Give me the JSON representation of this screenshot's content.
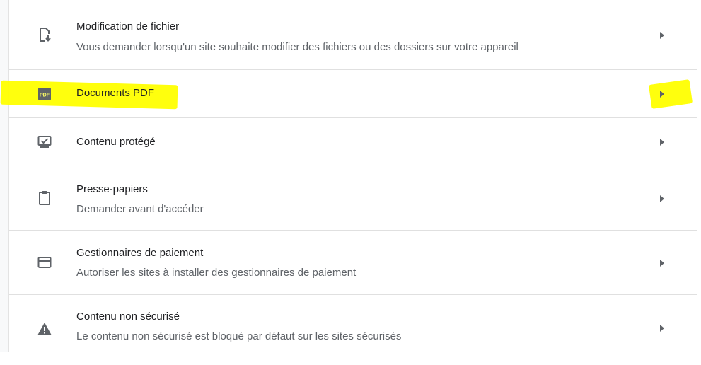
{
  "settings": {
    "items": [
      {
        "icon": "file-edit-icon",
        "title": "Modification de fichier",
        "subtitle": "Vous demander lorsqu'un site souhaite modifier des fichiers ou des dossiers sur votre appareil"
      },
      {
        "icon": "pdf-icon",
        "icon_text": "PDF",
        "title": "Documents PDF",
        "subtitle": ""
      },
      {
        "icon": "protected-content-icon",
        "title": "Contenu protégé",
        "subtitle": ""
      },
      {
        "icon": "clipboard-icon",
        "title": "Presse-papiers",
        "subtitle": "Demander avant d'accéder"
      },
      {
        "icon": "payment-card-icon",
        "title": "Gestionnaires de paiement",
        "subtitle": "Autoriser les sites à installer des gestionnaires de paiement"
      },
      {
        "icon": "warning-icon",
        "title": "Contenu non sécurisé",
        "subtitle": "Le contenu non sécurisé est bloqué par défaut sur les sites sécurisés"
      }
    ]
  },
  "colors": {
    "highlight": "#ffff00",
    "title_text": "#202124",
    "subtitle_text": "#5f6368",
    "icon": "#5f6368",
    "divider": "#e0e0e0"
  }
}
